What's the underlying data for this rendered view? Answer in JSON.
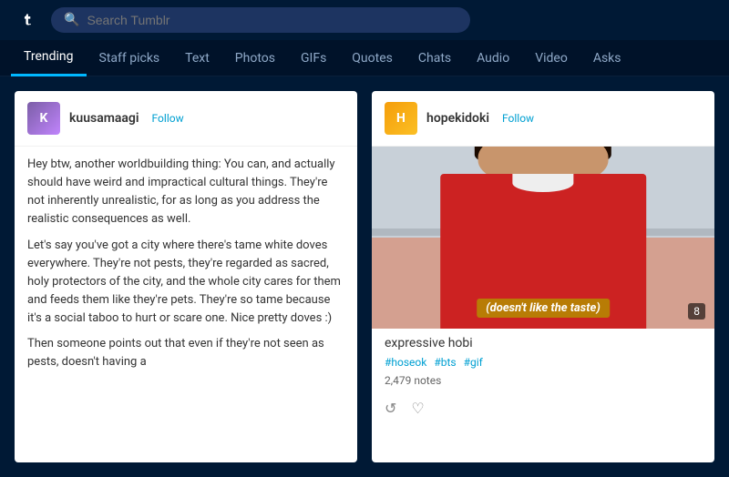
{
  "header": {
    "logo_alt": "Tumblr",
    "search_placeholder": "Search Tumblr"
  },
  "nav": {
    "items": [
      {
        "label": "Trending",
        "active": true
      },
      {
        "label": "Staff picks",
        "active": false
      },
      {
        "label": "Text",
        "active": false
      },
      {
        "label": "Photos",
        "active": false
      },
      {
        "label": "GIFs",
        "active": false
      },
      {
        "label": "Quotes",
        "active": false
      },
      {
        "label": "Chats",
        "active": false
      },
      {
        "label": "Audio",
        "active": false
      },
      {
        "label": "Video",
        "active": false
      },
      {
        "label": "Asks",
        "active": false
      }
    ]
  },
  "post_left": {
    "username": "kuusamaagi",
    "follow_label": "Follow",
    "paragraph1": " Hey btw, another worldbuilding thing: You can, and actually should have weird and impractical cultural things. They're not inherently unrealistic, for as long as you address the realistic consequences as well.",
    "paragraph2": " Let's say you've got a city where there's tame white doves everywhere. They're not pests, they're regarded as sacred, holy protectors of the city, and the whole city cares for them and feeds them like they're pets. They're so tame because it's a social taboo to hurt or scare one. Nice pretty doves :)",
    "paragraph3": " Then someone points out that even if they're not seen as pests, doesn't having a"
  },
  "post_right": {
    "username": "hopekidoki",
    "follow_label": "Follow",
    "image_caption": "(doesn't like the taste)",
    "image_badge": "8",
    "post_title": "expressive hobi",
    "tags": [
      "#hoseok",
      "#bts",
      "#gif"
    ],
    "notes": "2,479 notes"
  }
}
